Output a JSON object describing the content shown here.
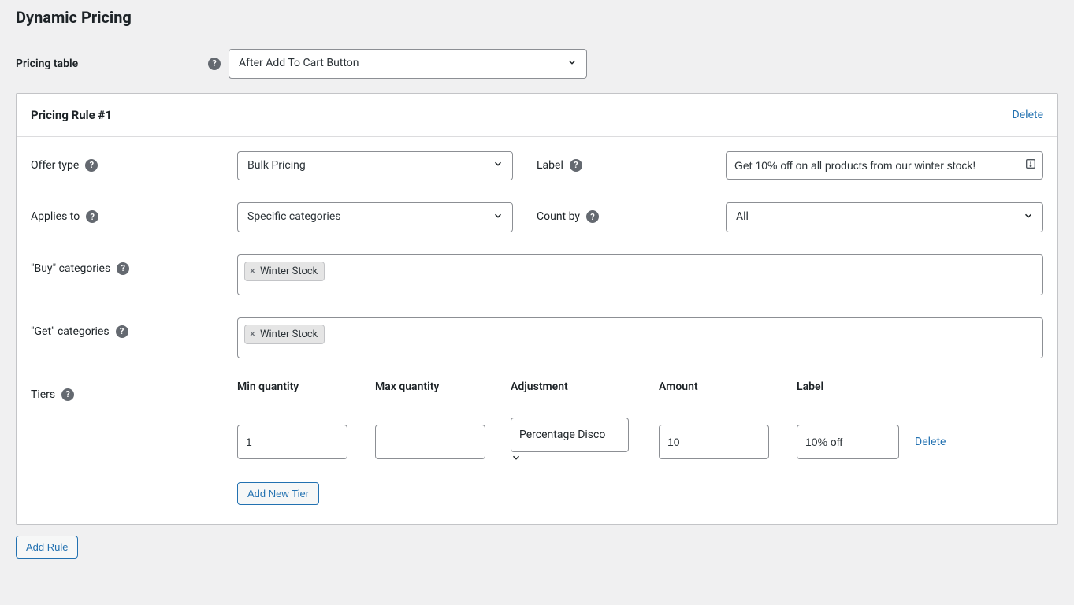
{
  "page": {
    "title": "Dynamic Pricing"
  },
  "pricing_table": {
    "label": "Pricing table",
    "selected": "After Add To Cart Button"
  },
  "rule": {
    "title": "Pricing Rule #1",
    "delete_label": "Delete",
    "offer_type": {
      "label": "Offer type",
      "selected": "Bulk Pricing"
    },
    "label_field": {
      "label": "Label",
      "value": "Get 10% off on all products from our winter stock!"
    },
    "applies_to": {
      "label": "Applies to",
      "selected": "Specific categories"
    },
    "count_by": {
      "label": "Count by",
      "selected": "All"
    },
    "buy_categories": {
      "label": "\"Buy\" categories",
      "tags": [
        "Winter Stock"
      ]
    },
    "get_categories": {
      "label": "\"Get\" categories",
      "tags": [
        "Winter Stock"
      ]
    },
    "tiers": {
      "label": "Tiers",
      "headers": {
        "min": "Min quantity",
        "max": "Max quantity",
        "adj": "Adjustment",
        "amt": "Amount",
        "lbl": "Label"
      },
      "rows": [
        {
          "min": "1",
          "max": "",
          "adjustment": "Percentage Discount",
          "amount": "10",
          "label": "10% off",
          "delete_label": "Delete"
        }
      ],
      "add_tier_label": "Add New Tier"
    }
  },
  "add_rule_label": "Add Rule"
}
